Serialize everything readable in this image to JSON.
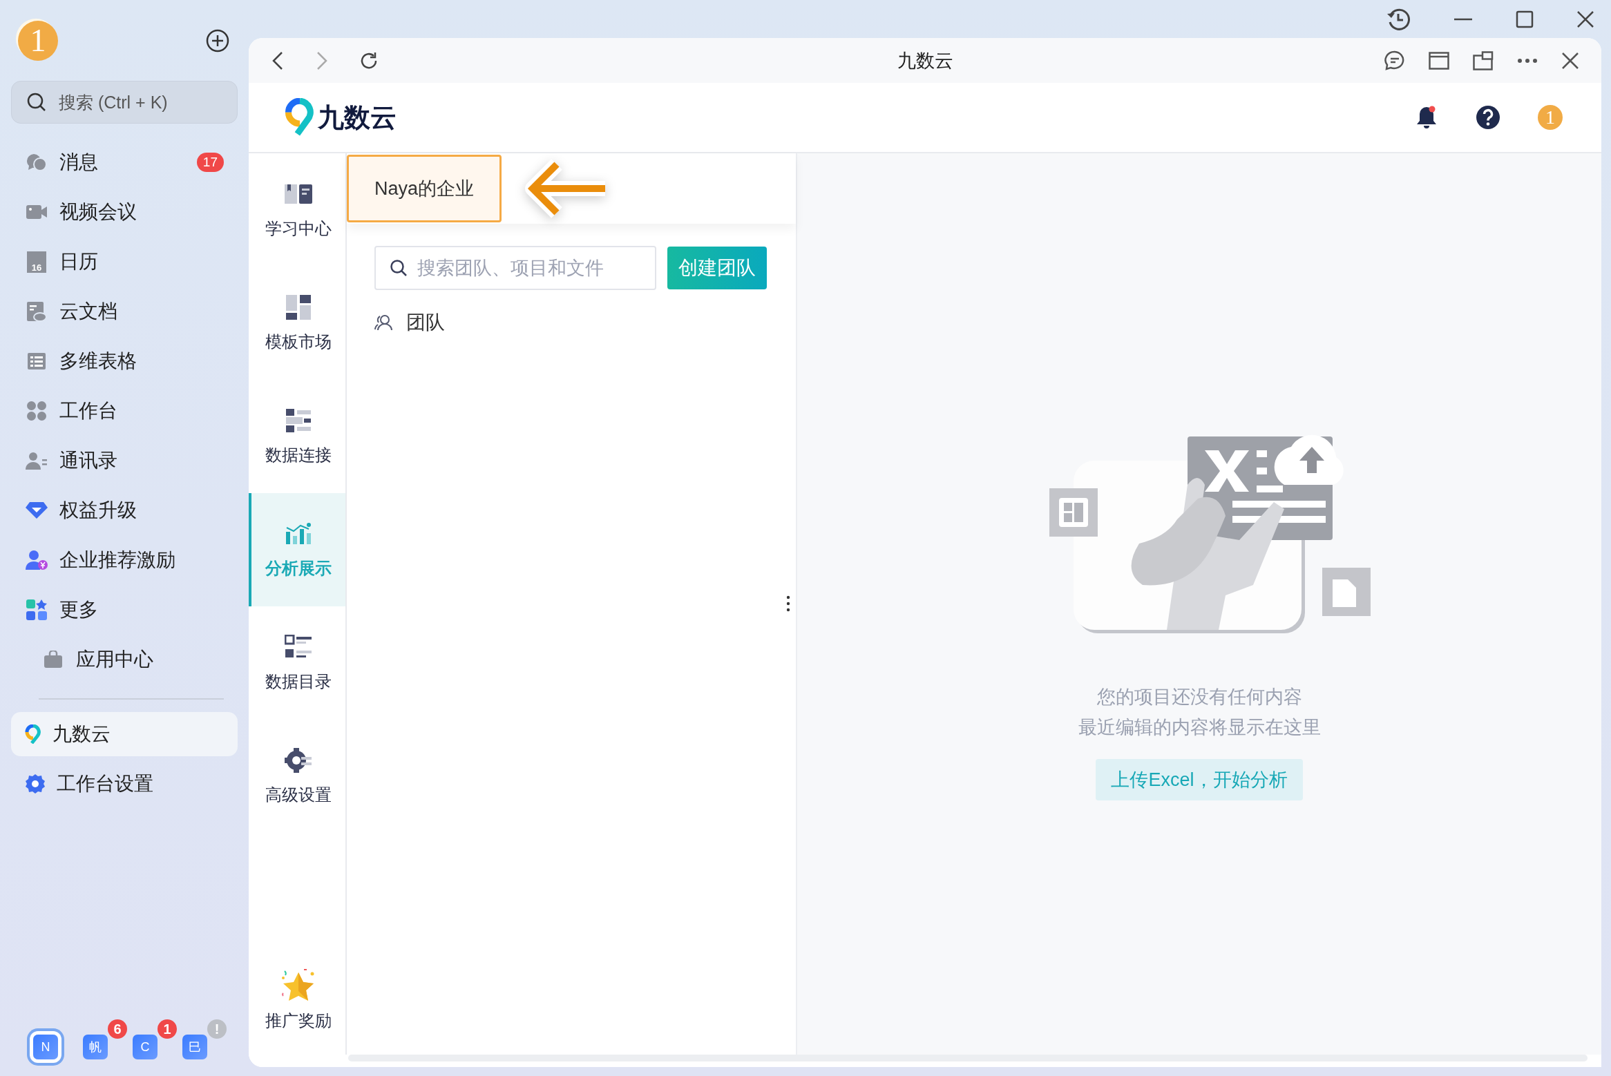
{
  "account": {
    "avatar": "1"
  },
  "search": {
    "placeholder": "搜索 (Ctrl + K)"
  },
  "sidebar": {
    "items": [
      {
        "label": "消息",
        "badge": "17",
        "selected": false,
        "indented": false
      },
      {
        "label": "视频会议",
        "selected": false,
        "indented": false
      },
      {
        "label": "日历",
        "icon_text": "16",
        "selected": false,
        "indented": false
      },
      {
        "label": "云文档",
        "selected": false,
        "indented": false
      },
      {
        "label": "多维表格",
        "selected": false,
        "indented": false
      },
      {
        "label": "工作台",
        "selected": false,
        "indented": false
      },
      {
        "label": "通讯录",
        "selected": false,
        "indented": false
      },
      {
        "label": "权益升级",
        "selected": false,
        "indented": false
      },
      {
        "label": "企业推荐激励",
        "selected": false,
        "indented": false
      },
      {
        "label": "更多",
        "selected": false,
        "indented": false
      },
      {
        "label": "应用中心",
        "selected": false,
        "indented": true
      }
    ],
    "pinned": [
      {
        "label": "九数云",
        "selected": true
      },
      {
        "label": "工作台设置",
        "selected": false
      }
    ],
    "apps": [
      {
        "letter": "N",
        "selected": true
      },
      {
        "letter": "帆",
        "badge": "6",
        "selected": false
      },
      {
        "letter": "C",
        "badge": "1",
        "selected": false
      },
      {
        "letter": "巳",
        "badge": "!",
        "selected": false
      }
    ]
  },
  "browser": {
    "title": "九数云"
  },
  "header": {
    "logo": "九数云",
    "avatar": "1"
  },
  "nav": {
    "items": [
      {
        "label": "学习中心",
        "selected": false
      },
      {
        "label": "模板市场",
        "selected": false
      },
      {
        "label": "数据连接",
        "selected": false
      },
      {
        "label": "分析展示",
        "selected": true
      },
      {
        "label": "数据目录",
        "selected": false
      },
      {
        "label": "高级设置",
        "selected": false
      }
    ],
    "bottom": {
      "label": "推广奖励"
    }
  },
  "teams_panel": {
    "enterprise": {
      "label": "Naya的企业",
      "highlighted": true
    },
    "search": {
      "placeholder": "搜索团队、项目和文件"
    },
    "create_button": "创建团队",
    "section": "团队"
  },
  "empty_state": {
    "lines": [
      "您的项目还没有任何内容",
      "最近编辑的内容将显示在这里"
    ],
    "button": "上传Excel，开始分析"
  }
}
